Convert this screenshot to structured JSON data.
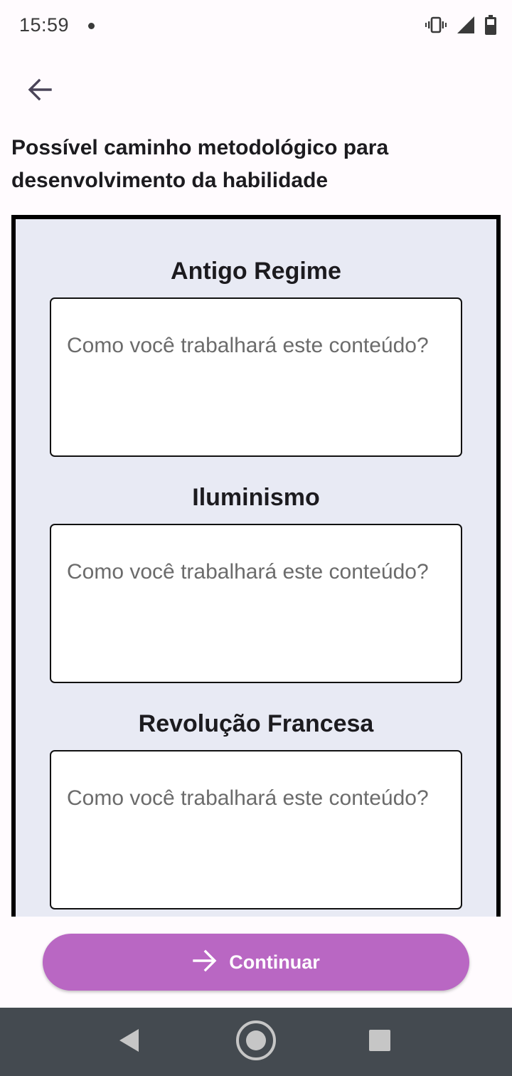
{
  "status_bar": {
    "time": "15:59",
    "icons": [
      "vibrate-icon",
      "signal-icon",
      "battery-icon"
    ]
  },
  "header": {
    "back_icon": "arrow-left-icon",
    "title": "Possível caminho metodológico para desenvolvimento da habilidade"
  },
  "sections": [
    {
      "title": "Antigo Regime",
      "placeholder": "Como você trabalhará este conteúdo?",
      "value": ""
    },
    {
      "title": "Iluminismo",
      "placeholder": "Como você trabalhará este conteúdo?",
      "value": ""
    },
    {
      "title": "Revolução Francesa",
      "placeholder": "Como você trabalhará este conteúdo?",
      "value": ""
    }
  ],
  "continue_button": {
    "label": "Continuar",
    "icon": "arrow-right-icon"
  },
  "nav_bar": {
    "icons": [
      "back-triangle-icon",
      "home-circle-icon",
      "recents-square-icon"
    ]
  },
  "colors": {
    "accent": "#b967c3",
    "panel_background": "#e8eaf4",
    "page_background": "#fffbfe",
    "nav_bar": "#444a50"
  }
}
